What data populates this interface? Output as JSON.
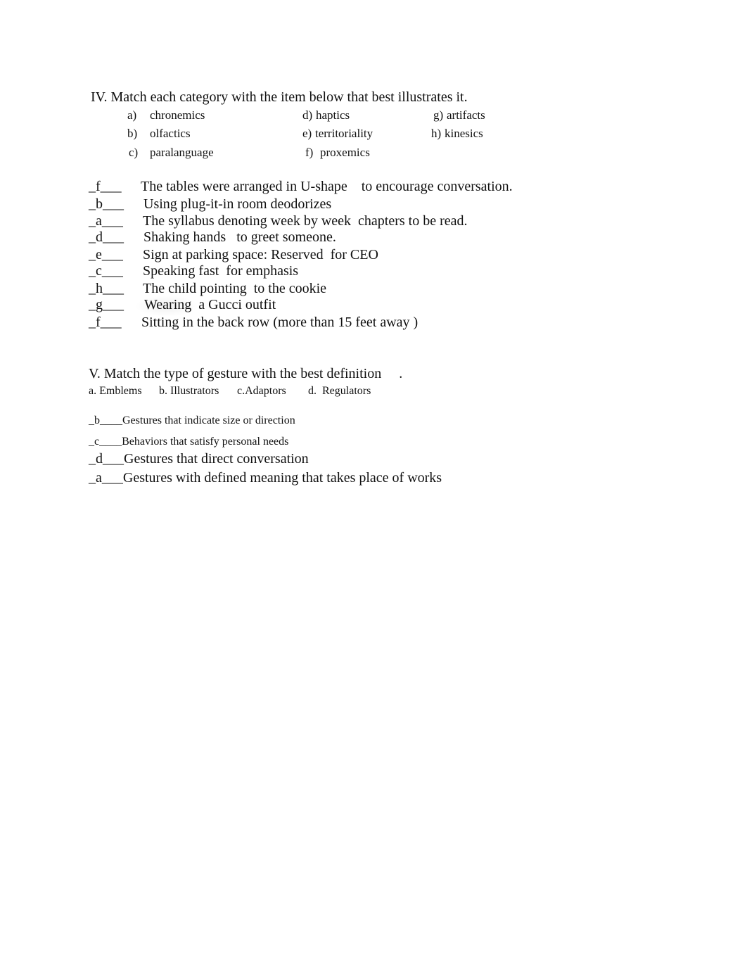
{
  "section4": {
    "heading": "IV. Match each category with the item below that best illustrates it.",
    "options": [
      {
        "letter": "a)",
        "label": "chronemics"
      },
      {
        "letter": "b)",
        "label": "olfactics"
      },
      {
        "letter": "c)",
        "label": "paralanguage"
      },
      {
        "letter": "d)",
        "label": "haptics"
      },
      {
        "letter": "e)",
        "label": "territoriality"
      },
      {
        "letter": "f)",
        "label": "proxemics"
      },
      {
        "letter": "g)",
        "label": "artifacts"
      },
      {
        "letter": "h)",
        "label": "kinesics"
      }
    ],
    "items": [
      {
        "answer": "_f___",
        "text": "The tables were arranged in U-shape    to encourage conversation."
      },
      {
        "answer": "_b___",
        "text": "Using plug-it-in room deodorizes"
      },
      {
        "answer": "_a___",
        "text": "The syllabus denoting week by week  chapters to be read."
      },
      {
        "answer": "_d___",
        "text": "Shaking hands   to greet someone."
      },
      {
        "answer": "_e___",
        "text": "Sign at parking space: Reserved  for CEO"
      },
      {
        "answer": "_c___",
        "text": "Speaking fast  for emphasis"
      },
      {
        "answer": "_h___",
        "text": "The child pointing  to the cookie"
      },
      {
        "answer": "_g___",
        "text": "Wearing  a Gucci outfit"
      },
      {
        "answer": "_f___",
        "text": "Sitting in the back row (more than 15 feet away )"
      }
    ]
  },
  "section5": {
    "heading": "V. Match the type of gesture with the best definition     .",
    "options": [
      {
        "letter": "a.",
        "label": "Emblems"
      },
      {
        "letter": "b.",
        "label": "Illustrators"
      },
      {
        "letter": "c.",
        "label": "Adaptors"
      },
      {
        "letter": "d.",
        "label": "Regulators"
      }
    ],
    "items": [
      {
        "answer": "_b____",
        "text": "Gestures that indicate size or direction"
      },
      {
        "answer": "_c____",
        "text": "Behaviors that satisfy personal needs"
      },
      {
        "answer": "_d___",
        "text": "Gestures that direct conversation"
      },
      {
        "answer": "_a___",
        "text": "Gestures with defined meaning that takes place of works"
      }
    ]
  }
}
